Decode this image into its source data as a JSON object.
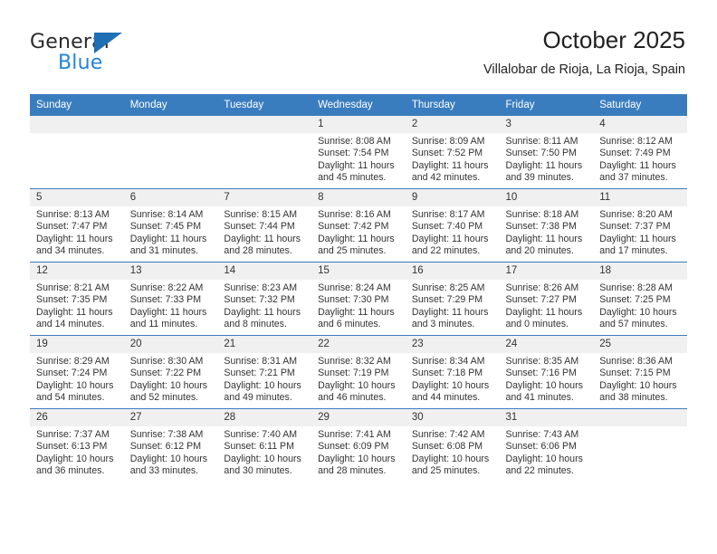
{
  "brand": {
    "name_top": "General",
    "name_bottom": "Blue",
    "triangle_color": "#1f6fb5",
    "blue_text_color": "#2484d6"
  },
  "header": {
    "title": "October 2025",
    "subtitle": "Villalobar de Rioja, La Rioja, Spain"
  },
  "theme": {
    "header_bg": "#3a7dbf",
    "daynum_bg": "#f0f0f0",
    "grid_line": "#3a7dbf",
    "text": "#333333"
  },
  "labels": {
    "sunrise_prefix": "Sunrise:",
    "sunset_prefix": "Sunset:",
    "daylight_prefix": "Daylight:"
  },
  "weekday_headers": [
    "Sunday",
    "Monday",
    "Tuesday",
    "Wednesday",
    "Thursday",
    "Friday",
    "Saturday"
  ],
  "weeks": [
    [
      {
        "blank": true
      },
      {
        "blank": true
      },
      {
        "blank": true
      },
      {
        "day": "1",
        "sunrise": "Sunrise: 8:08 AM",
        "sunset": "Sunset: 7:54 PM",
        "daylight_l1": "Daylight: 11 hours",
        "daylight_l2": "and 45 minutes."
      },
      {
        "day": "2",
        "sunrise": "Sunrise: 8:09 AM",
        "sunset": "Sunset: 7:52 PM",
        "daylight_l1": "Daylight: 11 hours",
        "daylight_l2": "and 42 minutes."
      },
      {
        "day": "3",
        "sunrise": "Sunrise: 8:11 AM",
        "sunset": "Sunset: 7:50 PM",
        "daylight_l1": "Daylight: 11 hours",
        "daylight_l2": "and 39 minutes."
      },
      {
        "day": "4",
        "sunrise": "Sunrise: 8:12 AM",
        "sunset": "Sunset: 7:49 PM",
        "daylight_l1": "Daylight: 11 hours",
        "daylight_l2": "and 37 minutes."
      }
    ],
    [
      {
        "day": "5",
        "sunrise": "Sunrise: 8:13 AM",
        "sunset": "Sunset: 7:47 PM",
        "daylight_l1": "Daylight: 11 hours",
        "daylight_l2": "and 34 minutes."
      },
      {
        "day": "6",
        "sunrise": "Sunrise: 8:14 AM",
        "sunset": "Sunset: 7:45 PM",
        "daylight_l1": "Daylight: 11 hours",
        "daylight_l2": "and 31 minutes."
      },
      {
        "day": "7",
        "sunrise": "Sunrise: 8:15 AM",
        "sunset": "Sunset: 7:44 PM",
        "daylight_l1": "Daylight: 11 hours",
        "daylight_l2": "and 28 minutes."
      },
      {
        "day": "8",
        "sunrise": "Sunrise: 8:16 AM",
        "sunset": "Sunset: 7:42 PM",
        "daylight_l1": "Daylight: 11 hours",
        "daylight_l2": "and 25 minutes."
      },
      {
        "day": "9",
        "sunrise": "Sunrise: 8:17 AM",
        "sunset": "Sunset: 7:40 PM",
        "daylight_l1": "Daylight: 11 hours",
        "daylight_l2": "and 22 minutes."
      },
      {
        "day": "10",
        "sunrise": "Sunrise: 8:18 AM",
        "sunset": "Sunset: 7:38 PM",
        "daylight_l1": "Daylight: 11 hours",
        "daylight_l2": "and 20 minutes."
      },
      {
        "day": "11",
        "sunrise": "Sunrise: 8:20 AM",
        "sunset": "Sunset: 7:37 PM",
        "daylight_l1": "Daylight: 11 hours",
        "daylight_l2": "and 17 minutes."
      }
    ],
    [
      {
        "day": "12",
        "sunrise": "Sunrise: 8:21 AM",
        "sunset": "Sunset: 7:35 PM",
        "daylight_l1": "Daylight: 11 hours",
        "daylight_l2": "and 14 minutes."
      },
      {
        "day": "13",
        "sunrise": "Sunrise: 8:22 AM",
        "sunset": "Sunset: 7:33 PM",
        "daylight_l1": "Daylight: 11 hours",
        "daylight_l2": "and 11 minutes."
      },
      {
        "day": "14",
        "sunrise": "Sunrise: 8:23 AM",
        "sunset": "Sunset: 7:32 PM",
        "daylight_l1": "Daylight: 11 hours",
        "daylight_l2": "and 8 minutes."
      },
      {
        "day": "15",
        "sunrise": "Sunrise: 8:24 AM",
        "sunset": "Sunset: 7:30 PM",
        "daylight_l1": "Daylight: 11 hours",
        "daylight_l2": "and 6 minutes."
      },
      {
        "day": "16",
        "sunrise": "Sunrise: 8:25 AM",
        "sunset": "Sunset: 7:29 PM",
        "daylight_l1": "Daylight: 11 hours",
        "daylight_l2": "and 3 minutes."
      },
      {
        "day": "17",
        "sunrise": "Sunrise: 8:26 AM",
        "sunset": "Sunset: 7:27 PM",
        "daylight_l1": "Daylight: 11 hours",
        "daylight_l2": "and 0 minutes."
      },
      {
        "day": "18",
        "sunrise": "Sunrise: 8:28 AM",
        "sunset": "Sunset: 7:25 PM",
        "daylight_l1": "Daylight: 10 hours",
        "daylight_l2": "and 57 minutes."
      }
    ],
    [
      {
        "day": "19",
        "sunrise": "Sunrise: 8:29 AM",
        "sunset": "Sunset: 7:24 PM",
        "daylight_l1": "Daylight: 10 hours",
        "daylight_l2": "and 54 minutes."
      },
      {
        "day": "20",
        "sunrise": "Sunrise: 8:30 AM",
        "sunset": "Sunset: 7:22 PM",
        "daylight_l1": "Daylight: 10 hours",
        "daylight_l2": "and 52 minutes."
      },
      {
        "day": "21",
        "sunrise": "Sunrise: 8:31 AM",
        "sunset": "Sunset: 7:21 PM",
        "daylight_l1": "Daylight: 10 hours",
        "daylight_l2": "and 49 minutes."
      },
      {
        "day": "22",
        "sunrise": "Sunrise: 8:32 AM",
        "sunset": "Sunset: 7:19 PM",
        "daylight_l1": "Daylight: 10 hours",
        "daylight_l2": "and 46 minutes."
      },
      {
        "day": "23",
        "sunrise": "Sunrise: 8:34 AM",
        "sunset": "Sunset: 7:18 PM",
        "daylight_l1": "Daylight: 10 hours",
        "daylight_l2": "and 44 minutes."
      },
      {
        "day": "24",
        "sunrise": "Sunrise: 8:35 AM",
        "sunset": "Sunset: 7:16 PM",
        "daylight_l1": "Daylight: 10 hours",
        "daylight_l2": "and 41 minutes."
      },
      {
        "day": "25",
        "sunrise": "Sunrise: 8:36 AM",
        "sunset": "Sunset: 7:15 PM",
        "daylight_l1": "Daylight: 10 hours",
        "daylight_l2": "and 38 minutes."
      }
    ],
    [
      {
        "day": "26",
        "sunrise": "Sunrise: 7:37 AM",
        "sunset": "Sunset: 6:13 PM",
        "daylight_l1": "Daylight: 10 hours",
        "daylight_l2": "and 36 minutes."
      },
      {
        "day": "27",
        "sunrise": "Sunrise: 7:38 AM",
        "sunset": "Sunset: 6:12 PM",
        "daylight_l1": "Daylight: 10 hours",
        "daylight_l2": "and 33 minutes."
      },
      {
        "day": "28",
        "sunrise": "Sunrise: 7:40 AM",
        "sunset": "Sunset: 6:11 PM",
        "daylight_l1": "Daylight: 10 hours",
        "daylight_l2": "and 30 minutes."
      },
      {
        "day": "29",
        "sunrise": "Sunrise: 7:41 AM",
        "sunset": "Sunset: 6:09 PM",
        "daylight_l1": "Daylight: 10 hours",
        "daylight_l2": "and 28 minutes."
      },
      {
        "day": "30",
        "sunrise": "Sunrise: 7:42 AM",
        "sunset": "Sunset: 6:08 PM",
        "daylight_l1": "Daylight: 10 hours",
        "daylight_l2": "and 25 minutes."
      },
      {
        "day": "31",
        "sunrise": "Sunrise: 7:43 AM",
        "sunset": "Sunset: 6:06 PM",
        "daylight_l1": "Daylight: 10 hours",
        "daylight_l2": "and 22 minutes."
      },
      {
        "blank": true
      }
    ]
  ]
}
